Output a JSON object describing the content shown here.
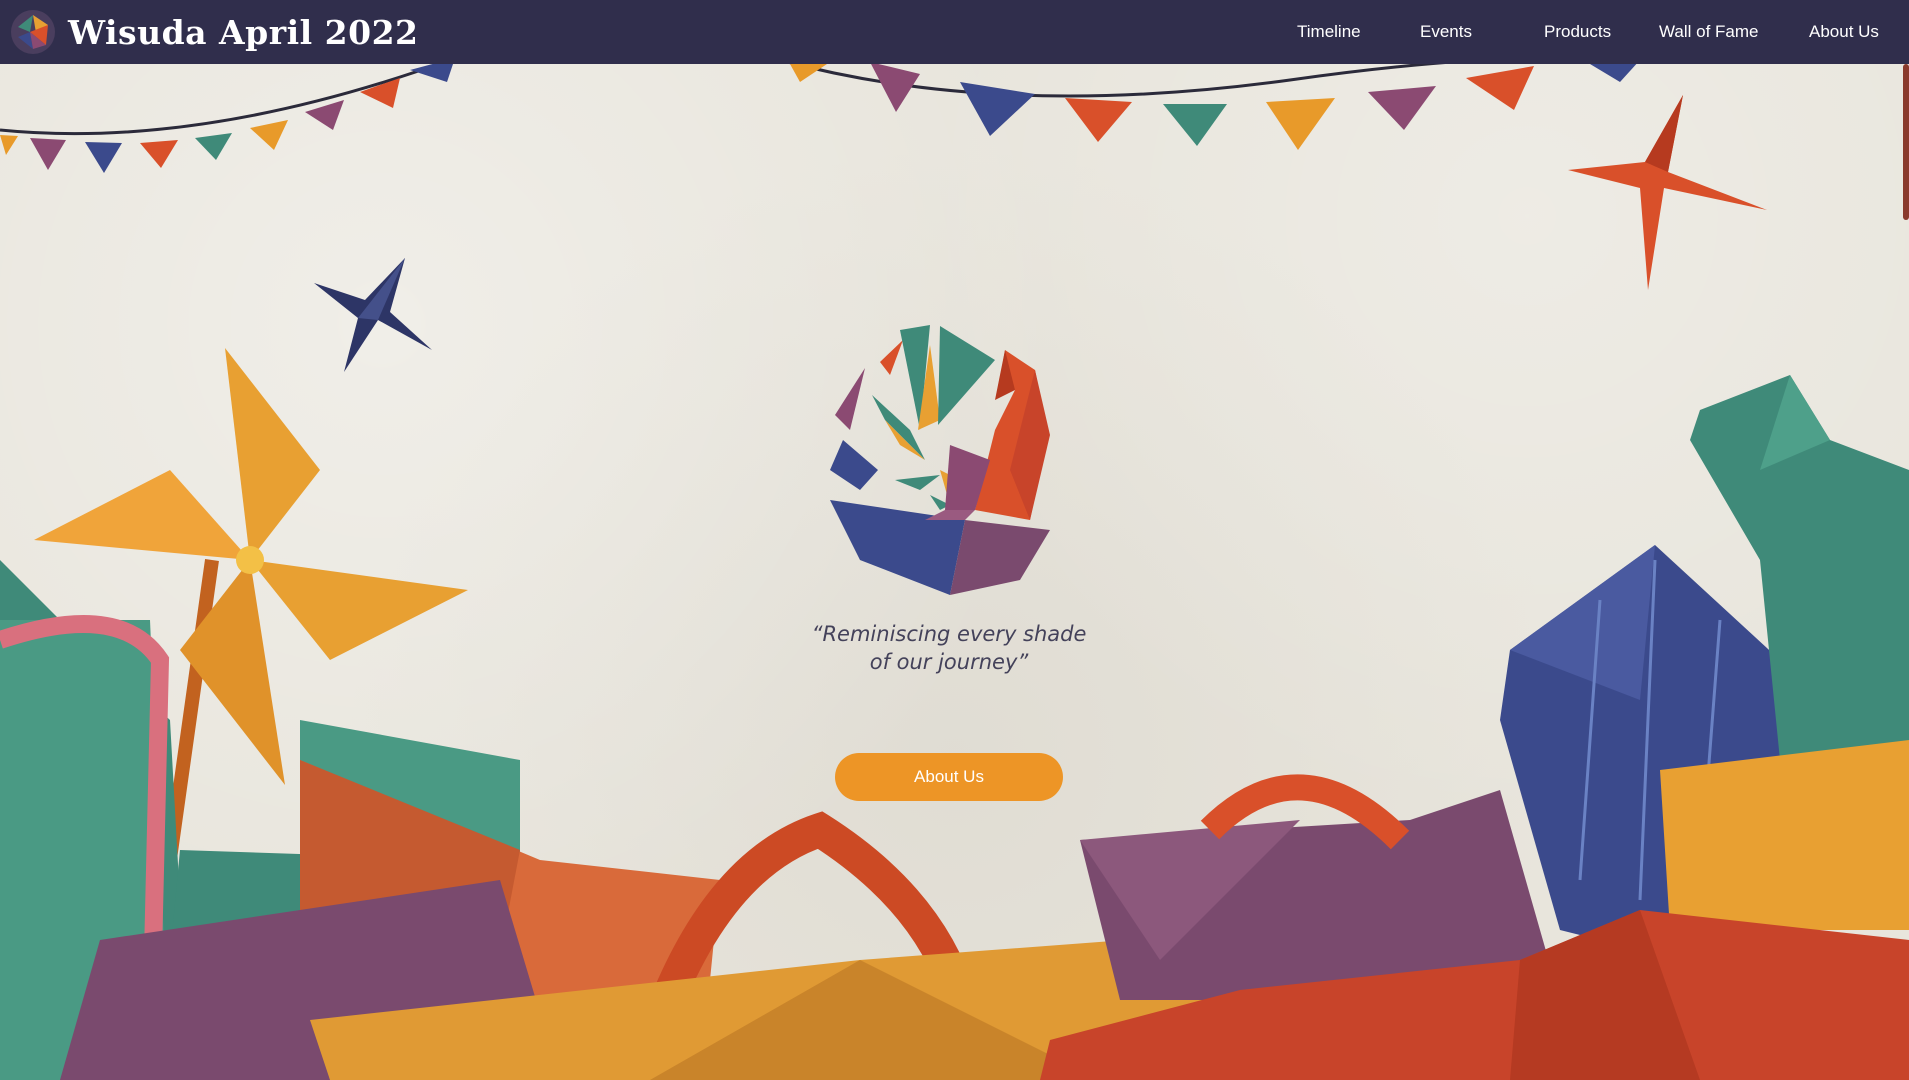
{
  "site": {
    "title": "Wisuda April 2022"
  },
  "nav": {
    "items": [
      "Timeline",
      "Events",
      "Products",
      "Wall of Fame",
      "About Us"
    ]
  },
  "hero": {
    "tagline_line1": "“Reminiscing every shade",
    "tagline_line2": "of our journey”",
    "cta_label": "About Us"
  },
  "colors": {
    "navbar": "#302e4c",
    "accent_orange": "#ed9526",
    "paper": "#e8e5dc",
    "teal": "#3f8a79",
    "navy": "#3b4a8c",
    "plum": "#7a4a6e",
    "red_orange": "#d9502a"
  },
  "icons": [
    "brand-logo-icon",
    "origami-bird-logo-icon",
    "pinwheel-icon",
    "origami-star-icon"
  ]
}
